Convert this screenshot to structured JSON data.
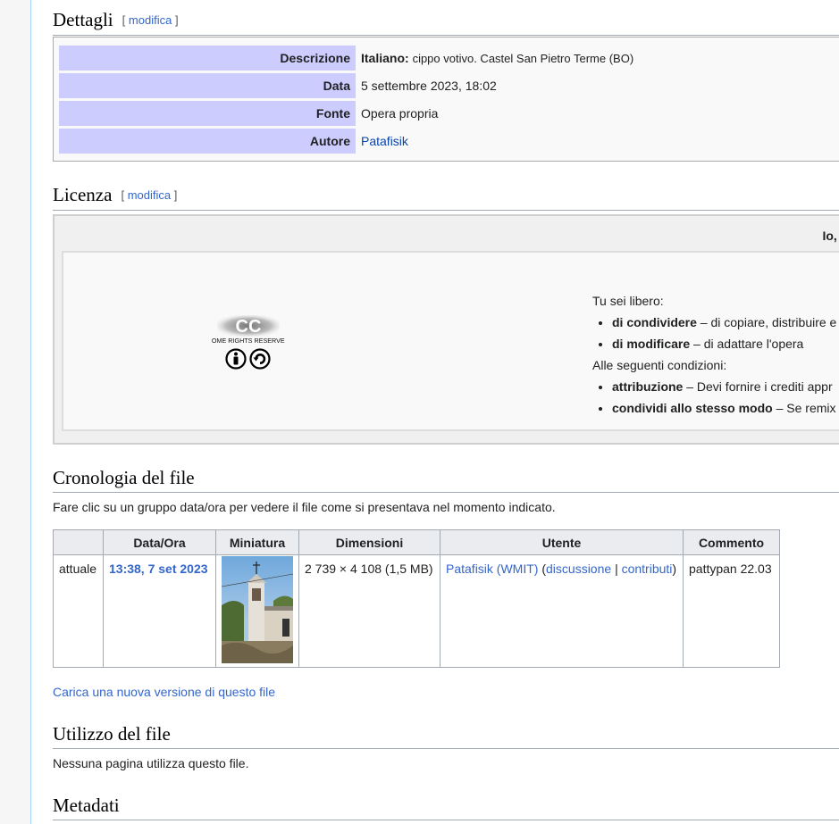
{
  "details": {
    "heading": "Dettagli",
    "edit_open": "[",
    "edit_label": "modifica",
    "edit_close": "]",
    "rows": [
      {
        "label": "Descrizione",
        "lang": "Italiano:",
        "value": "cippo votivo. Castel San Pietro Terme (BO)"
      },
      {
        "label": "Data",
        "value": "5 settembre 2023, 18:02"
      },
      {
        "label": "Fonte",
        "value": "Opera propria"
      },
      {
        "label": "Autore",
        "value": "Patafisik"
      }
    ]
  },
  "license": {
    "heading": "Licenza",
    "edit_label": "modifica",
    "header_text": "Io, de",
    "cc_logo_text": "CC",
    "cc_sub_text": "SOME RIGHTS RESERVED",
    "free_intro": "Tu sei libero:",
    "free_items": [
      {
        "term": "di condividere",
        "desc": " – di copiare, distribuire e"
      },
      {
        "term": "di modificare",
        "desc": " – di adattare l'opera"
      }
    ],
    "cond_intro": "Alle seguenti condizioni:",
    "cond_items": [
      {
        "term": "attribuzione",
        "desc": " – Devi fornire i crediti appr"
      },
      {
        "term": "condividi allo stesso modo",
        "desc": " – Se remix"
      }
    ]
  },
  "history": {
    "heading": "Cronologia del file",
    "intro": "Fare clic su un gruppo data/ora per vedere il file come si presentava nel momento indicato.",
    "columns": [
      "",
      "Data/Ora",
      "Miniatura",
      "Dimensioni",
      "Utente",
      "Commento"
    ],
    "row": {
      "status": "attuale",
      "datetime": "13:38, 7 set 2023",
      "dimensions": "2 739 × 4 108 (1,5 MB)",
      "user": "Patafisik (WMIT)",
      "talk_open": "(",
      "talk": "discussione",
      "sep": "|",
      "contribs": "contributi",
      "talk_close": ")",
      "comment": "pattypan 22.03"
    },
    "upload_link": "Carica una nuova versione di questo file"
  },
  "usage": {
    "heading": "Utilizzo del file",
    "text": "Nessuna pagina utilizza questo file."
  },
  "metadata": {
    "heading": "Metadati"
  },
  "colors": {
    "label_bg": "#ccccff",
    "link": "#3366cc",
    "border": "#a2a9b1"
  }
}
